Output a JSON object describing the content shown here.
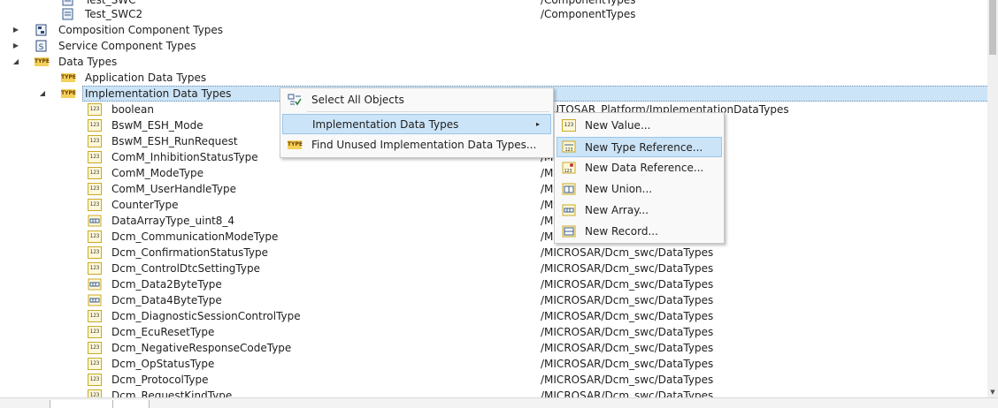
{
  "tree": {
    "rows": [
      {
        "label": "Test_SWC",
        "path": "/ComponentTypes",
        "icon": "swc-icon"
      },
      {
        "label": "Test_SWC2",
        "path": "/ComponentTypes",
        "icon": "swc-icon"
      },
      {
        "label": "Composition Component Types",
        "path": "",
        "icon": "composition-icon"
      },
      {
        "label": "Service Component Types",
        "path": "",
        "icon": "service-icon"
      },
      {
        "label": "Data Types",
        "path": "",
        "icon": "type-folder-icon"
      },
      {
        "label": "Application Data Types",
        "path": "",
        "icon": "type-folder-icon"
      },
      {
        "label": "Implementation Data Types",
        "path": "",
        "icon": "type-folder-icon"
      },
      {
        "label": "boolean",
        "path": "/AUTOSAR_Platform/ImplementationDataTypes",
        "icon": "value-type-icon"
      },
      {
        "label": "BswM_ESH_Mode",
        "path": "",
        "icon": "value-type-icon"
      },
      {
        "label": "BswM_ESH_RunRequest",
        "path": "",
        "icon": "value-type-icon"
      },
      {
        "label": "ComM_InhibitionStatusType",
        "path": "/M",
        "icon": "value-type-icon"
      },
      {
        "label": "ComM_ModeType",
        "path": "/M",
        "icon": "value-type-icon"
      },
      {
        "label": "ComM_UserHandleType",
        "path": "/M",
        "icon": "value-type-icon"
      },
      {
        "label": "CounterType",
        "path": "/M",
        "icon": "value-type-icon"
      },
      {
        "label": "DataArrayType_uint8_4",
        "path": "/M",
        "icon": "array-type-icon"
      },
      {
        "label": "Dcm_CommunicationModeType",
        "path": "/M",
        "icon": "value-type-icon"
      },
      {
        "label": "Dcm_ConfirmationStatusType",
        "path": "/MICROSAR/Dcm_swc/DataTypes",
        "icon": "value-type-icon"
      },
      {
        "label": "Dcm_ControlDtcSettingType",
        "path": "/MICROSAR/Dcm_swc/DataTypes",
        "icon": "value-type-icon"
      },
      {
        "label": "Dcm_Data2ByteType",
        "path": "/MICROSAR/Dcm_swc/DataTypes",
        "icon": "array-type-icon"
      },
      {
        "label": "Dcm_Data4ByteType",
        "path": "/MICROSAR/Dcm_swc/DataTypes",
        "icon": "array-type-icon"
      },
      {
        "label": "Dcm_DiagnosticSessionControlType",
        "path": "/MICROSAR/Dcm_swc/DataTypes",
        "icon": "value-type-icon"
      },
      {
        "label": "Dcm_EcuResetType",
        "path": "/MICROSAR/Dcm_swc/DataTypes",
        "icon": "value-type-icon"
      },
      {
        "label": "Dcm_NegativeResponseCodeType",
        "path": "/MICROSAR/Dcm_swc/DataTypes",
        "icon": "value-type-icon"
      },
      {
        "label": "Dcm_OpStatusType",
        "path": "/MICROSAR/Dcm_swc/DataTypes",
        "icon": "value-type-icon"
      },
      {
        "label": "Dcm_ProtocolType",
        "path": "/MICROSAR/Dcm_swc/DataTypes",
        "icon": "value-type-icon"
      },
      {
        "label": "Dcm_RequestKindType",
        "path": "/MICROSAR/Dcm_swc/DataTypes",
        "icon": "value-type-icon"
      }
    ]
  },
  "context_menu": {
    "items": [
      {
        "label": "Select All Objects",
        "icon": "select-all-icon"
      },
      {
        "label": "Implementation Data Types",
        "icon": "",
        "submenu_arrow": "▸"
      },
      {
        "label": "Find Unused Implementation Data Types...",
        "icon": "type-folder-icon"
      }
    ]
  },
  "submenu": {
    "items": [
      {
        "label": "New Value...",
        "icon": "new-value-icon"
      },
      {
        "label": "New Type Reference...",
        "icon": "new-type-reference-icon"
      },
      {
        "label": "New Data Reference...",
        "icon": "new-data-reference-icon"
      },
      {
        "label": "New Union...",
        "icon": "new-union-icon"
      },
      {
        "label": "New Array...",
        "icon": "new-array-icon"
      },
      {
        "label": "New Record...",
        "icon": "new-record-icon"
      }
    ]
  },
  "colors": {
    "selection": "#cce4f7",
    "selection_border": "#99c6eb",
    "menu_bg": "#f9f9f9",
    "type_icon": "#f2d05a"
  }
}
